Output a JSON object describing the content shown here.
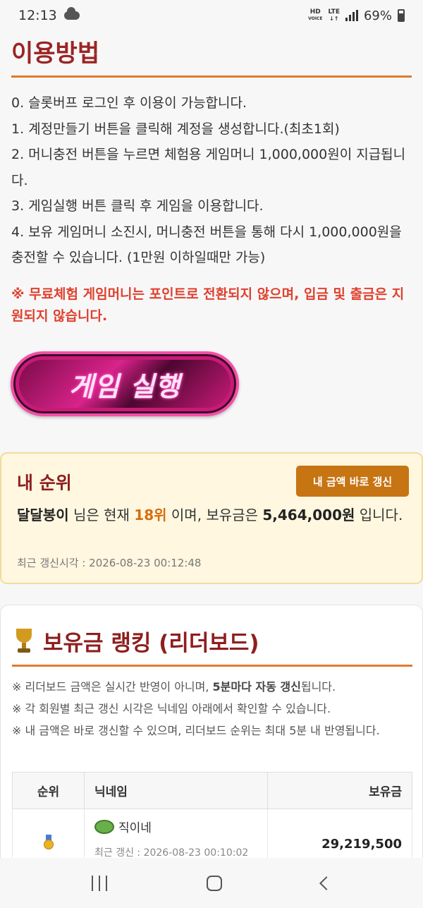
{
  "status": {
    "time": "12:13",
    "hd": "HD",
    "voice": "VOICE",
    "lte": "LTE",
    "battery": "69%"
  },
  "usage": {
    "title": "이용방법",
    "lines": [
      "0. 슬롯버프 로그인 후 이용이 가능합니다.",
      "1. 계정만들기 버튼을 클릭해 계정을 생성합니다.(최초1회)",
      "2. 머니충전 버튼을 누르면 체험용 게임머니 1,000,000원이 지급됩니다.",
      "3. 게임실행 버튼 클릭 후 게임을 이용합니다.",
      "4. 보유 게임머니 소진시, 머니충전 버튼을 통해 다시 1,000,000원을 충전할 수 있습니다. (1만원 이하일때만 가능)"
    ],
    "notice": "※ 무료체험 게임머니는 포인트로 전환되지 않으며, 입금 및 출금은 지원되지 않습니다."
  },
  "game_button": {
    "label": "게임 실행"
  },
  "my_rank": {
    "title": "내 순위",
    "refresh_label": "내 금액 바로 갱신",
    "nickname": "달달봉이",
    "text_after_name": " 님은 현재 ",
    "rank": "18위",
    "text_mid": " 이며, 보유금은 ",
    "amount": "5,464,000원",
    "text_end": " 입니다.",
    "updated": "최근 갱신시각 : 2026-08-23 00:12:48"
  },
  "leaderboard": {
    "title": "보유금 랭킹 (리더보드)",
    "note1_a": "※ 리더보드 금액은 실시간 반영이 아니며, ",
    "note1_b": "5분마다 자동 갱신",
    "note1_c": "됩니다.",
    "note2": "※ 각 회원별 최근 갱신 시각은 닉네임 아래에서 확인할 수 있습니다.",
    "note3": "※ 내 금액은 바로 갱신할 수 있으며, 리더보드 순위는 최대 5분 내 반영됩니다.",
    "columns": [
      "순위",
      "닉네임",
      "보유금"
    ],
    "rows": [
      {
        "nickname": "직이네",
        "updated": "최근 갱신 : 2026-08-23 00:10:02",
        "amount": "29,219,500"
      }
    ]
  }
}
